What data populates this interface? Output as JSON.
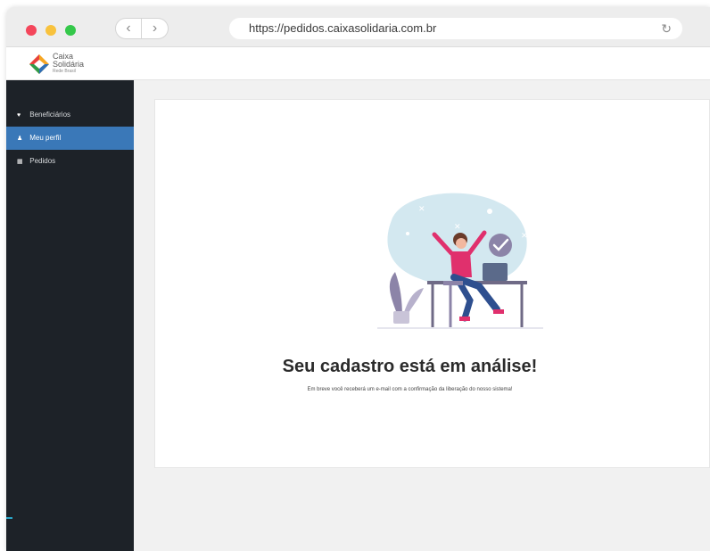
{
  "browser": {
    "url": "https://pedidos.caixasolidaria.com.br",
    "back_glyph": "‹",
    "forward_glyph": "›",
    "reload_glyph": "↻"
  },
  "app": {
    "logo": {
      "line1": "Caixa",
      "line2": "Solidária",
      "tagline": "Rede Brasil"
    }
  },
  "sidebar": {
    "items": [
      {
        "label": "Beneficiários",
        "icon": "heart-icon",
        "glyph": "♥",
        "active": false
      },
      {
        "label": "Meu perfil",
        "icon": "user-icon",
        "glyph": "♟",
        "active": true
      },
      {
        "label": "Pedidos",
        "icon": "list-icon",
        "glyph": "▦",
        "active": false
      }
    ]
  },
  "main": {
    "title": "Seu cadastro está em análise!",
    "subtitle": "Em breve você receberá um e-mail com a confirmação da liberação do nosso sistema!"
  },
  "colors": {
    "sidebar_bg": "#1d2228",
    "active_item": "#3a78b8",
    "illustration_blob": "#d3e8f0",
    "figure_top": "#e0306d",
    "figure_pants": "#2e4f8f",
    "check": "#8c84a8"
  }
}
